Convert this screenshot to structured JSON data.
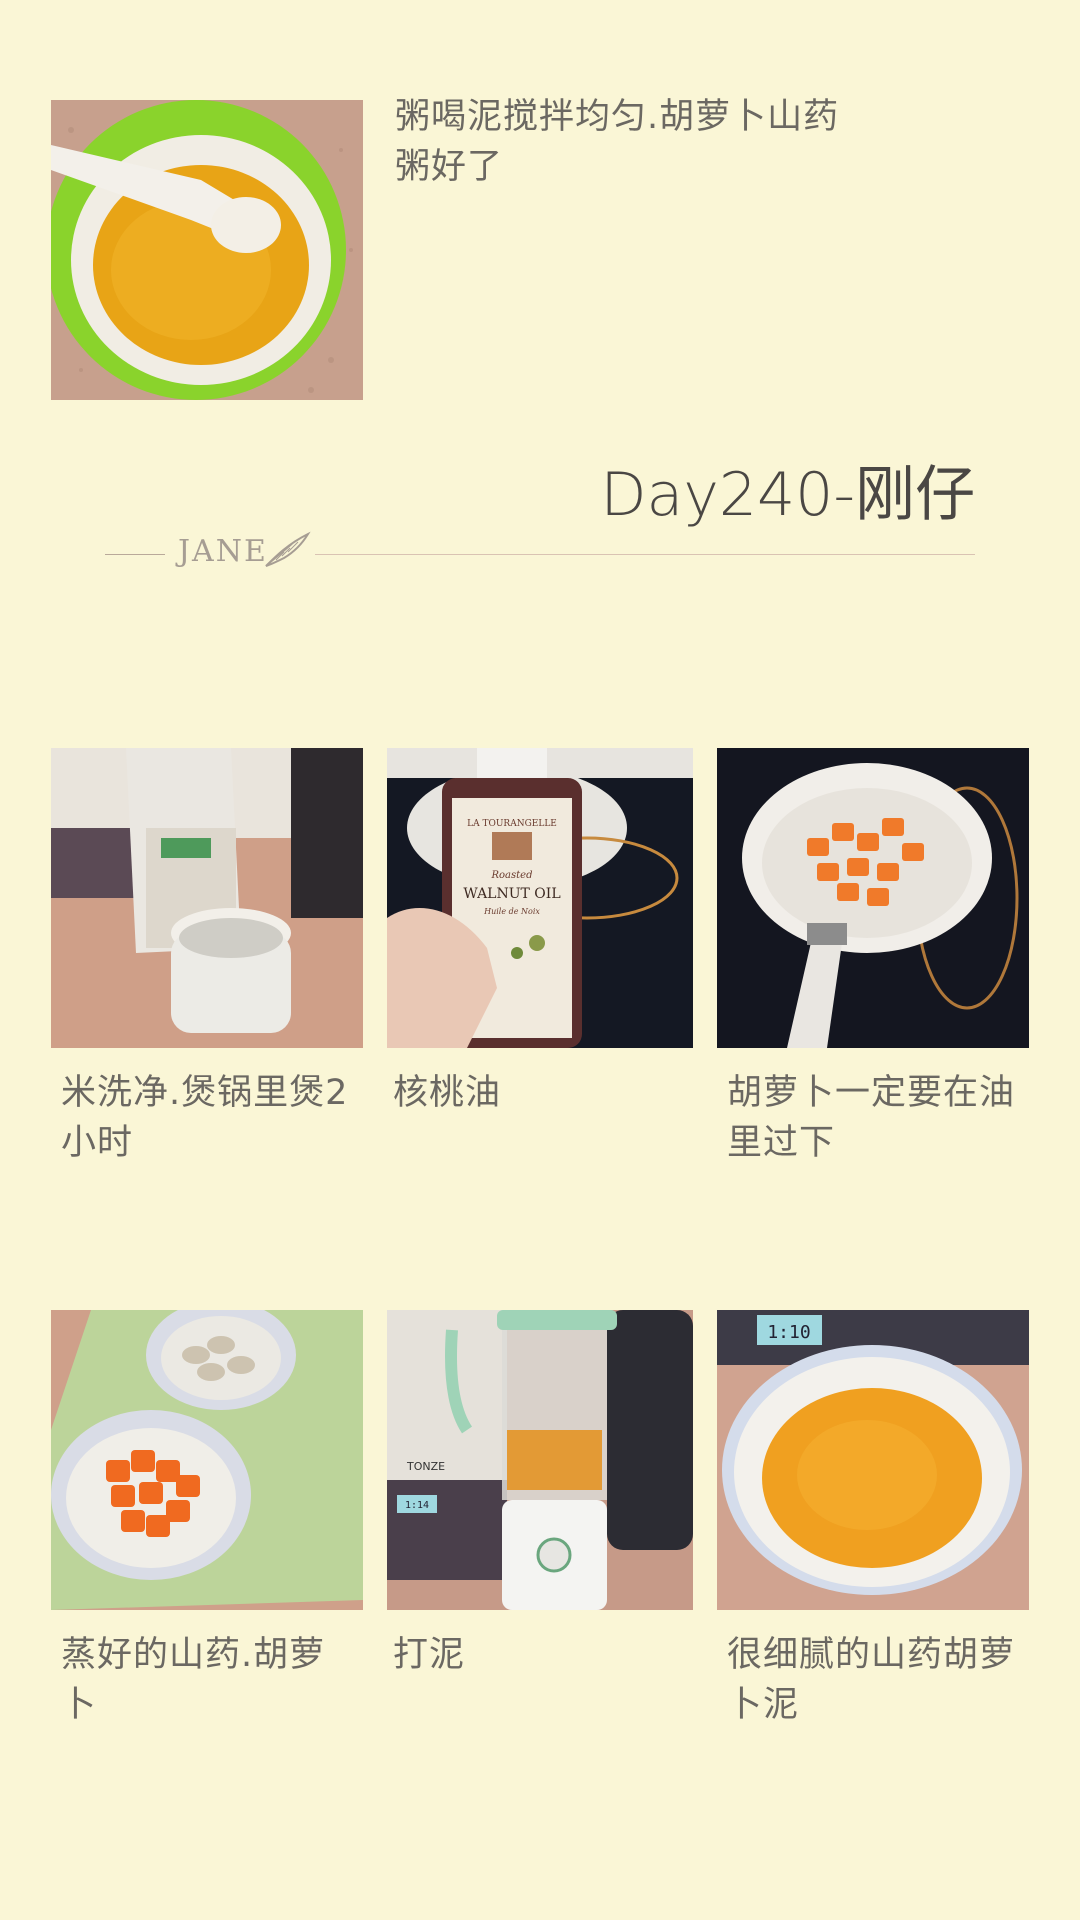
{
  "steps_top": [
    {
      "caption": "粥喝泥搅拌均匀.胡萝卜山药粥好了"
    }
  ],
  "header": {
    "day_title": "Day240-刚仔",
    "signature": "JANE"
  },
  "steps_row1": [
    {
      "caption": "米洗净.煲锅里煲2小时"
    },
    {
      "caption": "核桃油"
    },
    {
      "caption": "胡萝卜一定要在油里过下"
    }
  ],
  "steps_row2": [
    {
      "caption": "蒸好的山药.胡萝卜"
    },
    {
      "caption": "打泥"
    },
    {
      "caption": "很细腻的山药胡萝卜泥"
    }
  ],
  "photo_labels": {
    "oil_brand": "LA TOURANGELLE",
    "oil_sub": "Roasted",
    "oil_name": "WALNUT OIL",
    "oil_fr": "Huile de Noix",
    "cooker_display": "1:14",
    "cooker_display2": "1:10",
    "blender_brand": "TONZE"
  },
  "colors": {
    "background": "#faf6d6",
    "caption_text": "#6b6862",
    "title_text": "#4a4744"
  }
}
